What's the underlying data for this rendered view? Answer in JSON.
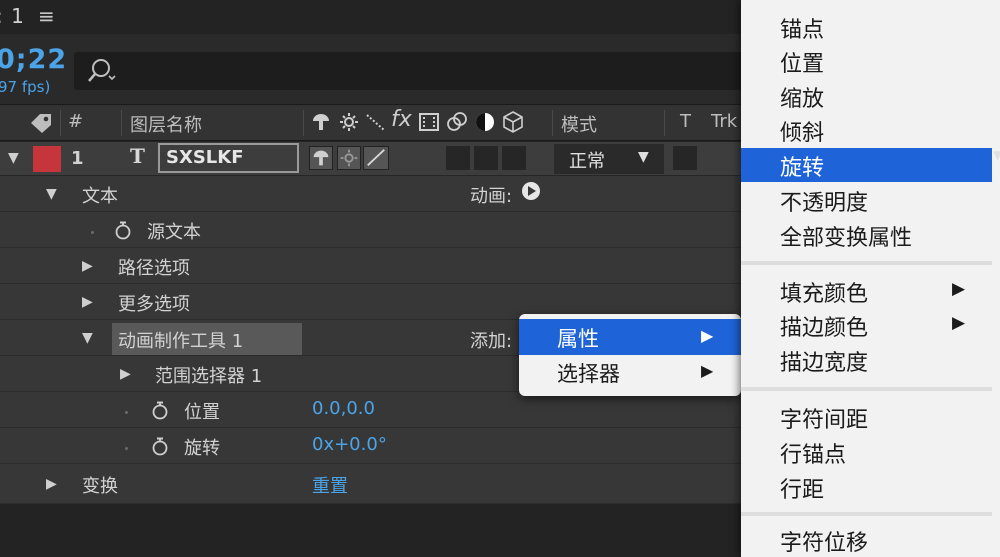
{
  "panel": {
    "tab_title": "1",
    "menu_icon": "≡",
    "timecode": "0;22",
    "fps": "97 fps)"
  },
  "search": {
    "placeholder": ""
  },
  "columns": {
    "number": "#",
    "layer_name": "图层名称",
    "mode": "模式",
    "t": "T",
    "trkmat": "Trk"
  },
  "layer": {
    "index": "1",
    "type_icon": "T",
    "name": "SXSLKF",
    "mode_value": "正常",
    "label_color": "#c5353b"
  },
  "properties": [
    {
      "id": "text",
      "label": "文本",
      "extra_label": "动画:"
    },
    {
      "id": "source-text",
      "label": "源文本"
    },
    {
      "id": "path-options",
      "label": "路径选项"
    },
    {
      "id": "more-options",
      "label": "更多选项"
    },
    {
      "id": "animator",
      "label": "动画制作工具 1",
      "extra_label": "添加:"
    },
    {
      "id": "range-selector",
      "label": "范围选择器 1"
    },
    {
      "id": "position",
      "label": "位置",
      "value": "0.0,0.0"
    },
    {
      "id": "rotation",
      "label": "旋转",
      "value": "0x+0.0°"
    },
    {
      "id": "transform",
      "label": "变换",
      "value": "重置"
    }
  ],
  "context_menu": {
    "items": [
      {
        "label": "属性",
        "has_submenu": true,
        "selected": true
      },
      {
        "label": "选择器",
        "has_submenu": true,
        "selected": false
      }
    ]
  },
  "submenu": {
    "items": [
      {
        "label": "锚点"
      },
      {
        "label": "位置"
      },
      {
        "label": "缩放"
      },
      {
        "label": "倾斜"
      },
      {
        "label": "旋转",
        "selected": true
      },
      {
        "label": "不透明度"
      },
      {
        "label": "全部变换属性"
      },
      {
        "label": "填充颜色",
        "has_submenu": true
      },
      {
        "label": "描边颜色",
        "has_submenu": true
      },
      {
        "label": "描边宽度"
      },
      {
        "label": "字符间距"
      },
      {
        "label": "行锚点"
      },
      {
        "label": "行距"
      },
      {
        "label": "字符位移"
      }
    ],
    "arrow": "▶"
  },
  "colors": {
    "accent_blue": "#4ba3e8",
    "selection": "#1f63d8"
  }
}
